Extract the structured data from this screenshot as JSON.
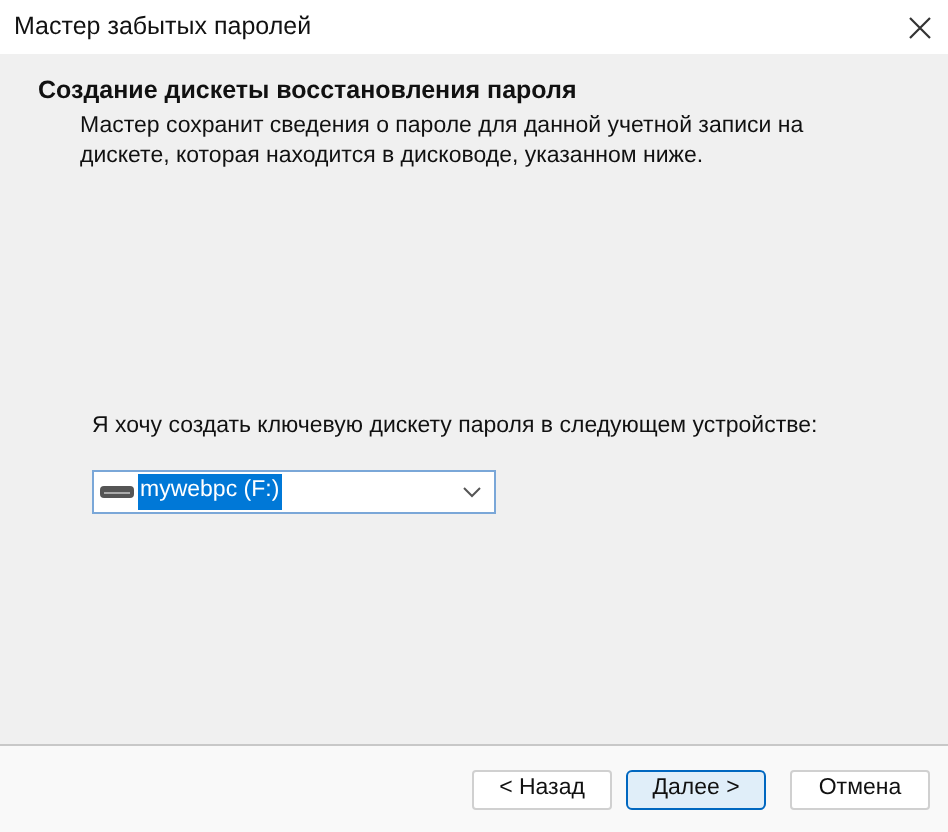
{
  "window": {
    "title": "Мастер забытых паролей"
  },
  "header": {
    "title": "Создание дискеты восстановления пароля",
    "description": "Мастер сохранит сведения о пароле для данной учетной записи на дискете, которая находится в дисководе, указанном ниже."
  },
  "device_label": "Я хочу создать ключевую дискету пароля в следующем устройстве:",
  "device_select": {
    "value": "mywebpc (F:)"
  },
  "buttons": [
    {
      "label": "< Назад",
      "default": false
    },
    {
      "label": "Далее >",
      "default": true
    },
    {
      "label": "Отмена",
      "default": false
    }
  ]
}
